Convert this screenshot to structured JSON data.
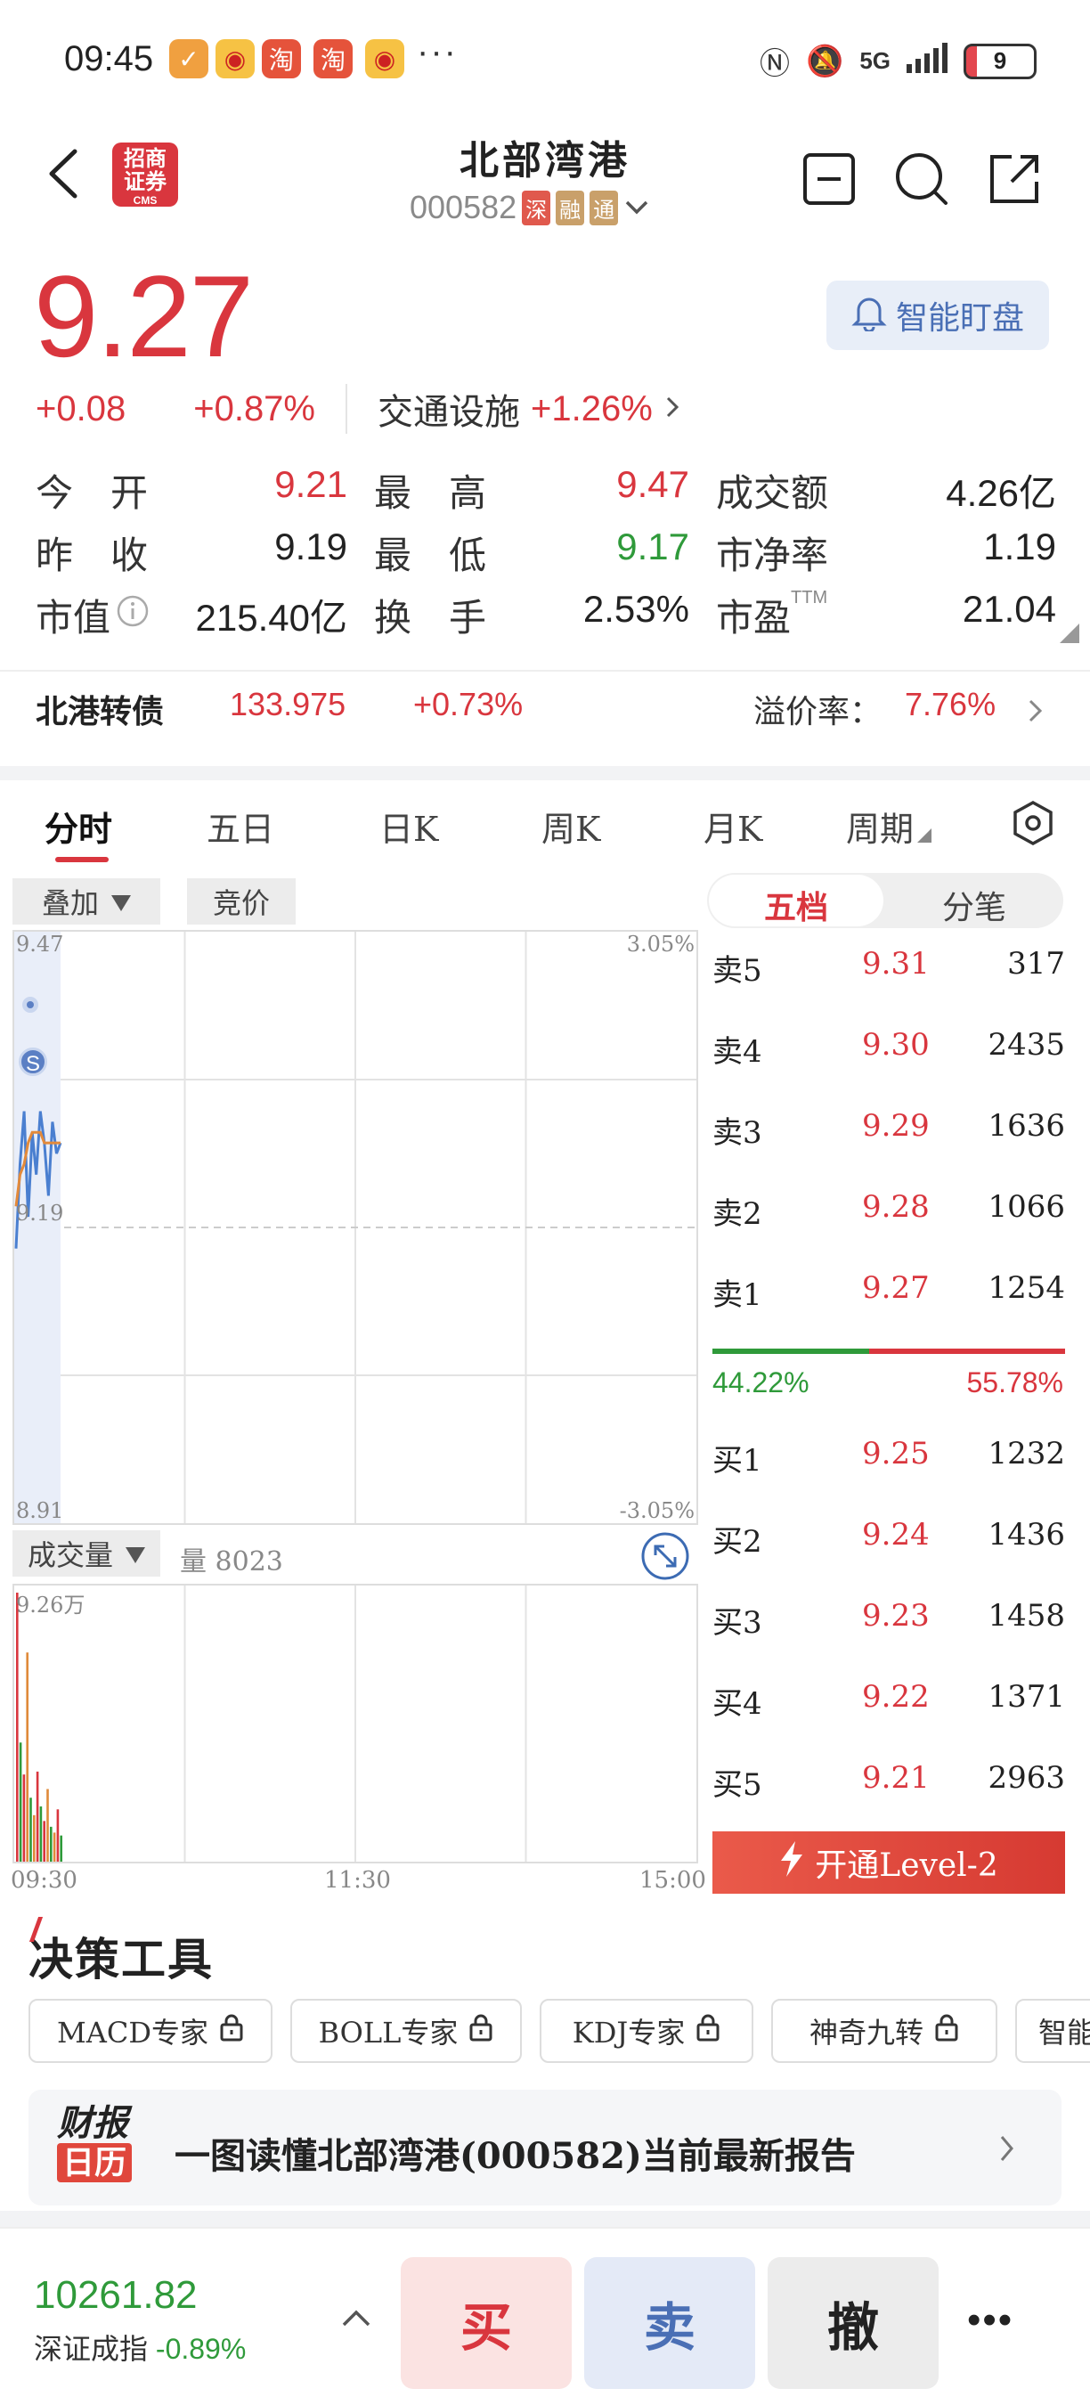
{
  "status_bar": {
    "time": "09:45",
    "network": "5G",
    "battery": "9"
  },
  "header": {
    "broker_logo": "招商证券",
    "broker_logo_sub": "CMS",
    "title": "北部湾港",
    "code": "000582",
    "tags": [
      "深",
      "融",
      "通"
    ]
  },
  "quote": {
    "price": "9.27",
    "change": "+0.08",
    "change_pct": "+0.87%",
    "sector_name": "交通设施",
    "sector_change": "+1.26%",
    "alert_button": "智能盯盘"
  },
  "stats": [
    {
      "label": "今　开",
      "value": "9.21",
      "color": "red"
    },
    {
      "label": "最　高",
      "value": "9.47",
      "color": "red"
    },
    {
      "label": "成交额",
      "value": "4.26亿",
      "color": "black"
    },
    {
      "label": "昨　收",
      "value": "9.19",
      "color": "black"
    },
    {
      "label": "最　低",
      "value": "9.17",
      "color": "green"
    },
    {
      "label": "市净率",
      "value": "1.19",
      "color": "black"
    },
    {
      "label": "市值",
      "value": "215.40亿",
      "color": "black"
    },
    {
      "label": "换　手",
      "value": "2.53%",
      "color": "black"
    },
    {
      "label": "市盈",
      "label_sup": "TTM",
      "value": "21.04",
      "color": "black"
    }
  ],
  "convertible": {
    "label": "北港转债",
    "price": "133.975",
    "change": "+0.73%",
    "premium_label": "溢价率：",
    "premium": "7.76%"
  },
  "chart_tabs": [
    "分时",
    "五日",
    "日K",
    "周K",
    "月K",
    "周期"
  ],
  "chart_chips": {
    "overlay": "叠加",
    "auction": "竞价"
  },
  "chart_axes": {
    "high": "9.47",
    "prev_close": "9.19",
    "low": "8.91",
    "high_pct": "3.05%",
    "low_pct": "-3.05%",
    "times": [
      "09:30",
      "11:30",
      "15:00"
    ],
    "signal_marker": "S"
  },
  "volume": {
    "chip": "成交量",
    "label": "量",
    "value": "8023",
    "max_label": "9.26万"
  },
  "chart_data": {
    "type": "line",
    "title": "",
    "xlabel": "",
    "ylabel": "",
    "ylim": [
      8.91,
      9.47
    ],
    "prev_close": 9.19,
    "series": [
      {
        "values": [
          9.17,
          9.25,
          9.3,
          9.2,
          9.28,
          9.24,
          9.3,
          9.27,
          9.22,
          9.29,
          9.26,
          9.27
        ]
      },
      {
        "values": [
          9.21,
          9.24,
          9.25,
          9.27,
          9.28,
          9.28,
          9.28,
          9.27,
          9.27,
          9.27,
          9.27,
          9.27
        ]
      }
    ],
    "volume_bars": [
      9.26,
      4.1,
      3.0,
      7.2,
      2.2,
      1.6,
      3.1,
      1.9,
      1.4,
      2.5,
      1.2,
      1.0,
      1.8,
      0.9
    ]
  },
  "order_book": {
    "tabs": [
      "五档",
      "分笔"
    ],
    "asks": [
      {
        "label": "卖5",
        "price": "9.31",
        "qty": "317"
      },
      {
        "label": "卖4",
        "price": "9.30",
        "qty": "2435"
      },
      {
        "label": "卖3",
        "price": "9.29",
        "qty": "1636"
      },
      {
        "label": "卖2",
        "price": "9.28",
        "qty": "1066"
      },
      {
        "label": "卖1",
        "price": "9.27",
        "qty": "1254"
      }
    ],
    "buy_ratio": "44.22%",
    "sell_ratio": "55.78%",
    "bids": [
      {
        "label": "买1",
        "price": "9.25",
        "qty": "1232"
      },
      {
        "label": "买2",
        "price": "9.24",
        "qty": "1436"
      },
      {
        "label": "买3",
        "price": "9.23",
        "qty": "1458"
      },
      {
        "label": "买4",
        "price": "9.22",
        "qty": "1371"
      },
      {
        "label": "买5",
        "price": "9.21",
        "qty": "2963"
      }
    ],
    "level2_button": "开通Level-2"
  },
  "tools": {
    "title": "决策工具",
    "items": [
      "MACD专家",
      "BOLL专家",
      "KDJ专家",
      "神奇九转",
      "智能"
    ],
    "banner_logo_top": "财报",
    "banner_logo_bottom": "日历",
    "banner_text": "一图读懂北部湾港(000582)当前最新报告"
  },
  "bottom": {
    "index_value": "10261.82",
    "index_name": "深证成指",
    "index_change": "-0.89%",
    "buy": "买",
    "sell": "卖",
    "cancel": "撤",
    "more": "•••"
  },
  "colors": {
    "up": "#d9363e",
    "down": "#2f9a3a",
    "accent_blue": "#4a6fb5"
  }
}
